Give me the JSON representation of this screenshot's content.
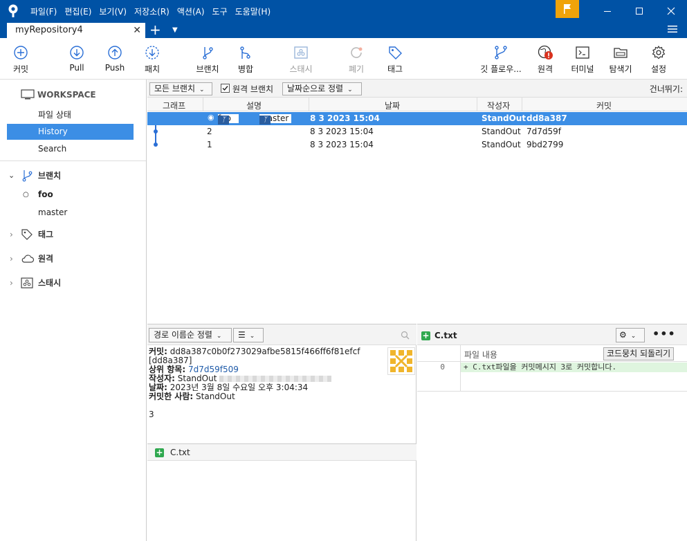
{
  "app": {
    "menu": [
      "파일(F)",
      "편집(E)",
      "보기(V)",
      "저장소(R)",
      "액션(A)",
      "도구",
      "도움말(H)"
    ],
    "tab_title": "myRepository4",
    "colors": {
      "brand": "#0052a5",
      "selection": "#3c8ee5",
      "flag": "#f0a30a",
      "added": "#2fa84f"
    }
  },
  "toolbar": {
    "commit": "커밋",
    "pull": "Pull",
    "push": "Push",
    "patch": "패치",
    "branch": "브랜치",
    "merge": "병합",
    "stash": "스태시",
    "discard": "폐기",
    "tag": "태그",
    "gitflow": "깃 플로우...",
    "remote": "원격",
    "terminal": "터미널",
    "explorer": "탐색기",
    "settings": "설정"
  },
  "sidebar": {
    "workspace": "WORKSPACE",
    "file_status": "파일 상태",
    "history": "History",
    "search": "Search",
    "branches": "브랜치",
    "branch_items": [
      "foo",
      "master"
    ],
    "tags": "태그",
    "remotes": "원격",
    "stashes": "스태시"
  },
  "filter": {
    "all_branches": "모든 브랜치",
    "remote_branches": "원격 브랜치",
    "sort_by_date": "날짜순으로 정렬",
    "skip": "건너뛰기:"
  },
  "history": {
    "columns": [
      "그래프",
      "설명",
      "날짜",
      "작성자",
      "커밋"
    ],
    "rows": [
      {
        "desc": "",
        "branches": [
          "foo",
          "master"
        ],
        "date": "8 3 2023 15:04",
        "author": "StandOut",
        "commit": "dd8a387"
      },
      {
        "desc": "2",
        "branches": [],
        "date": "8 3 2023 15:04",
        "author": "StandOut",
        "commit": "7d7d59f"
      },
      {
        "desc": "1",
        "branches": [],
        "date": "8 3 2023 15:04",
        "author": "StandOut",
        "commit": "9bd2799"
      }
    ]
  },
  "details": {
    "sort_label": "경로 이름순 정렬",
    "commit_label": "커밋:",
    "commit_hash": "dd8a387c0b0f273029afbe5815f466ff6f81efcf",
    "commit_short": "[dd8a387]",
    "parent_label": "상위 항목:",
    "parent_hash": "7d7d59f509",
    "author_label": "작성자:",
    "author_name": "StandOut",
    "date_label": "날짜:",
    "date_value": "2023년 3월 8일 수요일 오후 3:04:34",
    "committer_label": "커밋한 사람:",
    "committer_name": "StandOut",
    "message": "3",
    "file": "C.txt"
  },
  "diff": {
    "file": "C.txt",
    "content_label": "파일 내용",
    "revert_button": "코드뭉치 되돌리기",
    "line_number": "0",
    "line_text": "+ C.txt파일을 커밋메시지 3로 커밋합니다."
  }
}
